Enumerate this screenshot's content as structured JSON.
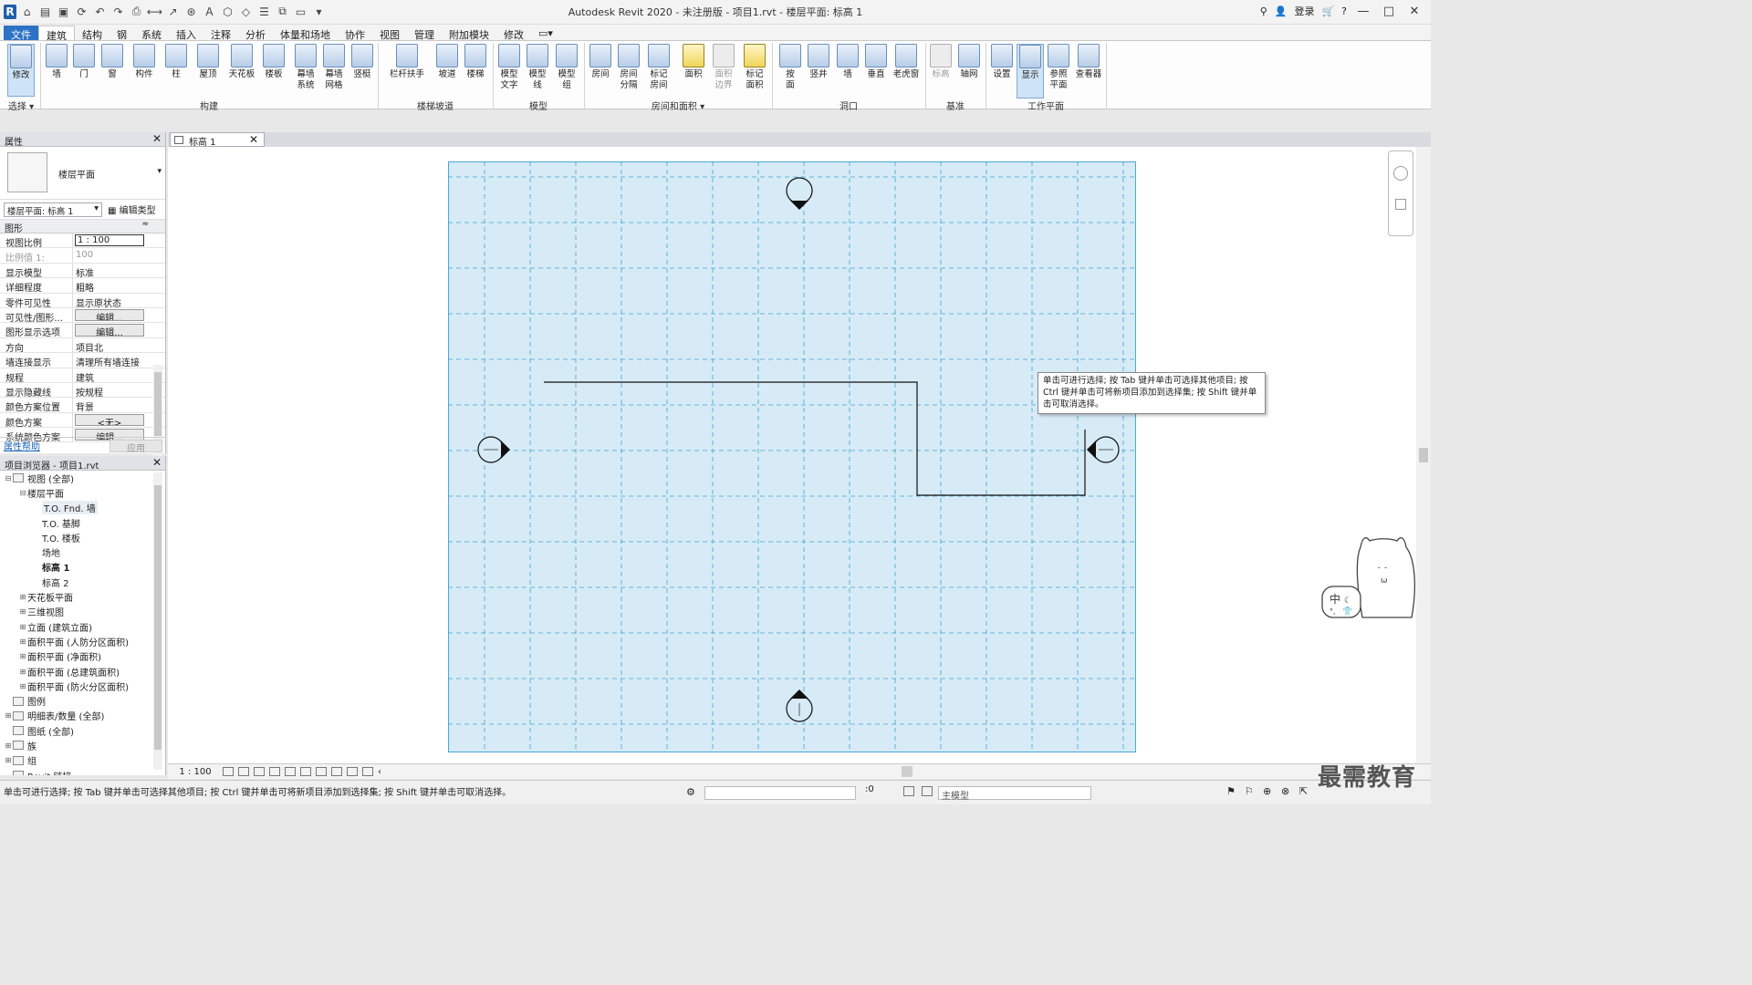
{
  "window": {
    "title": "Autodesk Revit 2020 - 未注册版 - 项目1.rvt - 楼层平面: 标高 1",
    "login": "登录"
  },
  "ribbon": {
    "tabs": [
      "文件",
      "建筑",
      "结构",
      "钢",
      "系统",
      "插入",
      "注释",
      "分析",
      "体量和场地",
      "协作",
      "视图",
      "管理",
      "附加模块",
      "修改"
    ],
    "active_tab": "建筑",
    "buttons": {
      "modify": "修改",
      "wall": "墙",
      "door": "门",
      "window": "窗",
      "component": "构件",
      "column": "柱",
      "roof": "屋顶",
      "ceiling": "天花板",
      "floor": "楼板",
      "curtain_system": "幕墙\n系统",
      "curtain_grid": "幕墙\n网格",
      "mullion": "竖梃",
      "railing": "栏杆扶手",
      "ramp": "坡道",
      "stair": "楼梯",
      "model_text": "模型\n文字",
      "model_line": "模型\n线",
      "model_group": "模型\n组",
      "room": "房间",
      "room_separator": "房间\n分隔",
      "tag_room": "标记\n房间",
      "area": "面积",
      "area_boundary": "面积\n边界",
      "tag_area": "标记\n面积",
      "by_face": "按\n面",
      "shaft": "竖井",
      "opening_wall": "墙",
      "vertical": "垂直",
      "dormer": "老虎窗",
      "level": "标高",
      "grid": "轴网",
      "set": "设置",
      "show": "显示",
      "ref_plane": "参照\n平面",
      "viewer": "查看器"
    },
    "panels": {
      "select": "选择",
      "build": "构建",
      "circulation": "楼梯坡道",
      "model": "模型",
      "room_area": "房间和面积",
      "opening": "洞口",
      "datum": "基准",
      "work_plane": "工作平面"
    }
  },
  "properties": {
    "title": "属性",
    "type_name": "楼层平面",
    "view_selector": "楼层平面: 标高 1",
    "edit_type": "编辑类型",
    "group": "图形",
    "rows": [
      {
        "k": "视图比例",
        "v": "1 : 100"
      },
      {
        "k": "比例值 1:",
        "v": "100"
      },
      {
        "k": "显示模型",
        "v": "标准"
      },
      {
        "k": "详细程度",
        "v": "粗略"
      },
      {
        "k": "零件可见性",
        "v": "显示原状态"
      },
      {
        "k": "可见性/图形...",
        "v": "编辑..."
      },
      {
        "k": "图形显示选项",
        "v": "编辑..."
      },
      {
        "k": "方向",
        "v": "项目北"
      },
      {
        "k": "墙连接显示",
        "v": "清理所有墙连接"
      },
      {
        "k": "规程",
        "v": "建筑"
      },
      {
        "k": "显示隐藏线",
        "v": "按规程"
      },
      {
        "k": "颜色方案位置",
        "v": "背景"
      },
      {
        "k": "颜色方案",
        "v": "<无>"
      },
      {
        "k": "系统颜色方案",
        "v": "编辑..."
      }
    ],
    "help_link": "属性帮助",
    "apply": "应用"
  },
  "browser": {
    "title": "项目浏览器 - 项目1.rvt",
    "items": [
      {
        "label": "视图 (全部)",
        "level": 0,
        "tog": "⊟",
        "icon": true
      },
      {
        "label": "楼层平面",
        "level": 1,
        "tog": "⊟"
      },
      {
        "label": "T.O. Fnd. 墙",
        "level": 2,
        "hl": true
      },
      {
        "label": "T.O. 基脚",
        "level": 2
      },
      {
        "label": "T.O. 楼板",
        "level": 2
      },
      {
        "label": "场地",
        "level": 2
      },
      {
        "label": "标高 1",
        "level": 2,
        "bold": true
      },
      {
        "label": "标高 2",
        "level": 2
      },
      {
        "label": "天花板平面",
        "level": 1,
        "tog": "⊞"
      },
      {
        "label": "三维视图",
        "level": 1,
        "tog": "⊞"
      },
      {
        "label": "立面 (建筑立面)",
        "level": 1,
        "tog": "⊞"
      },
      {
        "label": "面积平面 (人防分区面积)",
        "level": 1,
        "tog": "⊞"
      },
      {
        "label": "面积平面 (净面积)",
        "level": 1,
        "tog": "⊞"
      },
      {
        "label": "面积平面 (总建筑面积)",
        "level": 1,
        "tog": "⊞"
      },
      {
        "label": "面积平面 (防火分区面积)",
        "level": 1,
        "tog": "⊞"
      },
      {
        "label": "图例",
        "level": 0,
        "icon": true
      },
      {
        "label": "明细表/数量 (全部)",
        "level": 0,
        "tog": "⊞",
        "icon": true
      },
      {
        "label": "图纸 (全部)",
        "level": 0,
        "icon": true
      },
      {
        "label": "族",
        "level": 0,
        "tog": "⊞",
        "icon": true
      },
      {
        "label": "组",
        "level": 0,
        "tog": "⊞",
        "icon": true
      },
      {
        "label": "Revit 链接",
        "level": 0,
        "icon": true
      }
    ]
  },
  "view_tab": {
    "label": "标高 1"
  },
  "tooltip": "单击可进行选择; 按 Tab 键并单击可选择其他项目; 按 Ctrl 键并单击可将新项目添加到选择集; 按 Shift 键并单击可取消选择。",
  "viewctrl": {
    "scale": "1 : 100"
  },
  "status": {
    "text": "单击可进行选择; 按 Tab 键并单击可选择其他项目; 按 Ctrl 键并单击可将新项目添加到选择集; 按 Shift 键并单击可取消选择。",
    "coord": ":0",
    "model": "主模型"
  },
  "watermark": "最需教育",
  "ime": "中"
}
